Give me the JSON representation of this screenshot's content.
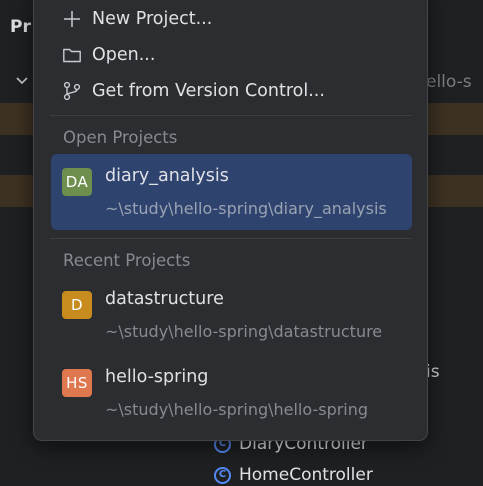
{
  "background": {
    "panel_title": "Pr",
    "right_text_top": "ello-s",
    "right_text_mid": "is",
    "classes": [
      {
        "label": "DiaryController",
        "icon": "class-icon"
      },
      {
        "label": "HomeController",
        "icon": "class-icon"
      }
    ],
    "class_icon_letter": "C"
  },
  "menu": {
    "actions": [
      {
        "label": "New Project...",
        "icon": "plus-icon"
      },
      {
        "label": "Open...",
        "icon": "folder-icon"
      },
      {
        "label": "Get from Version Control...",
        "icon": "vcs-branch-icon"
      }
    ],
    "open_projects_header": "Open Projects",
    "recent_projects_header": "Recent Projects",
    "open_projects": [
      {
        "badge": "DA",
        "badge_color": "#6e8e4d",
        "name": "diary_analysis",
        "path": "~\\study\\hello-spring\\diary_analysis",
        "selected": true
      }
    ],
    "recent_projects": [
      {
        "badge": "D",
        "badge_color": "#c88c1e",
        "name": "datastructure",
        "path": "~\\study\\hello-spring\\datastructure"
      },
      {
        "badge": "HS",
        "badge_color": "#e0784f",
        "name": "hello-spring",
        "path": "~\\study\\hello-spring\\hello-spring"
      }
    ]
  },
  "colors": {
    "selection": "#2e436e",
    "popup_bg": "#2b2d30",
    "highlight_row": "#3d3222",
    "accent_blue": "#548af7"
  }
}
